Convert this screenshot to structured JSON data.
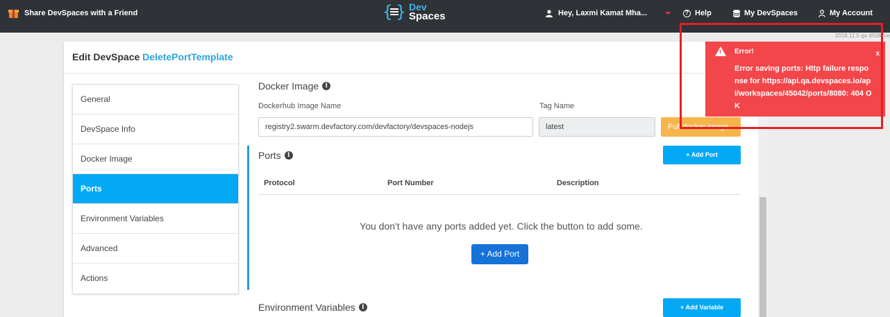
{
  "topbar": {
    "share_label": "Share DevSpaces with a Friend",
    "logo_line1": "Dev",
    "logo_line2": "Spaces",
    "user_greeting": "Hey, Laxmi Kamat Mha...",
    "help_label": "Help",
    "mydevspaces_label": "My DevSpaces",
    "account_label": "My Account",
    "corner_text": "2018.11.5 qa 45087ce"
  },
  "header": {
    "prefix": "Edit DevSpace",
    "devspace_name": "DeletePortTemplate"
  },
  "sidebar": {
    "items": [
      {
        "label": "General"
      },
      {
        "label": "DevSpace Info"
      },
      {
        "label": "Docker Image"
      },
      {
        "label": "Ports"
      },
      {
        "label": "Environment Variables"
      },
      {
        "label": "Advanced"
      },
      {
        "label": "Actions"
      }
    ],
    "active_index": 3
  },
  "docker": {
    "title": "Docker Image",
    "image_label": "Dockerhub Image Name",
    "image_value": "registry2.swarm.devfactory.com/devfactory/devspaces-nodejs",
    "tag_label": "Tag Name",
    "tag_value": "latest",
    "pull_label": "Pull docker image"
  },
  "ports": {
    "title": "Ports",
    "add_label": "Add Port",
    "col_protocol": "Protocol",
    "col_port": "Port Number",
    "col_description": "Description",
    "empty_text": "You don't have any ports added yet. Click the button to add some.",
    "empty_add_label": "Add Port"
  },
  "env": {
    "title": "Environment Variables",
    "add_label": "Add Variable"
  },
  "toast": {
    "title": "Error!",
    "message": "Error saving ports: Http failure response for https://api.qa.devspaces.io/api/workspaces/45042/ports/8080: 404 OK",
    "close": "x"
  },
  "colors": {
    "topbar": "#2f3237",
    "accent": "#03a9f4",
    "link": "#2aa5de",
    "toast": "#f2464a",
    "highlight": "#e21f26"
  }
}
